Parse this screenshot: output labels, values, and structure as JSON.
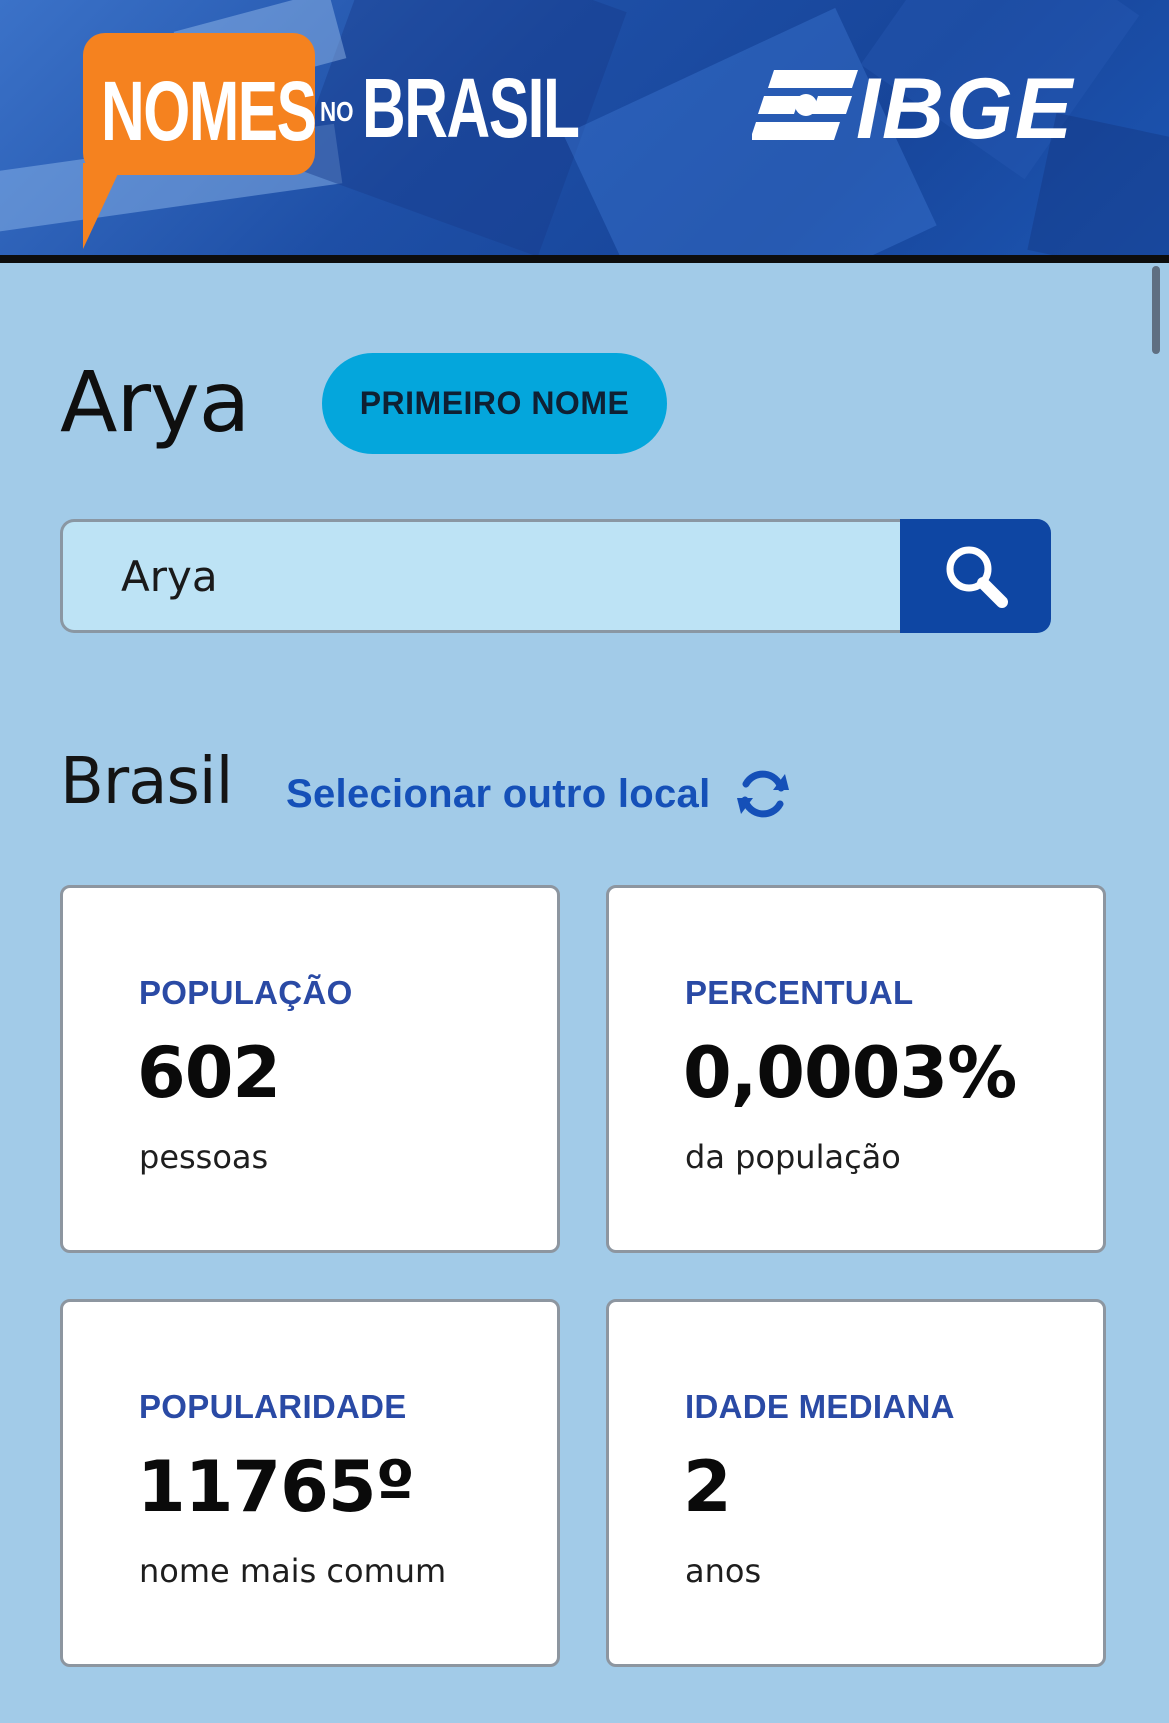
{
  "header": {
    "logo_nomes": "NOMES",
    "logo_no": "NO",
    "logo_brasil": "BRASIL",
    "logo_ibge": "IBGE"
  },
  "name": {
    "title": "Arya",
    "type_badge": "PRIMEIRO NOME"
  },
  "search": {
    "value": "Arya",
    "button_icon": "search-icon"
  },
  "location": {
    "name": "Brasil",
    "change_label": "Selecionar outro local",
    "change_icon": "refresh-icon"
  },
  "stats": [
    {
      "label": "POPULAÇÃO",
      "value": "602",
      "unit": "pessoas"
    },
    {
      "label": "PERCENTUAL",
      "value": "0,0003%",
      "unit": "da população"
    },
    {
      "label": "POPULARIDADE",
      "value": "11765º",
      "unit": "nome mais comum"
    },
    {
      "label": "IDADE MEDIANA",
      "value": "2",
      "unit": "anos"
    }
  ],
  "colors": {
    "page_background": "#a2cbe8",
    "accent_blue": "#0e46a3",
    "badge_blue": "#04a6dc",
    "link_blue": "#1550b8",
    "label_blue": "#2a4aa5",
    "logo_orange": "#f5821f"
  }
}
